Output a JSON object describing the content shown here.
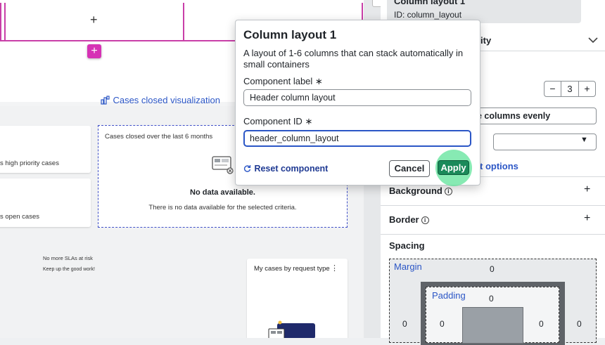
{
  "canvas": {
    "viz_link": "Cases closed visualization",
    "card_high_priority": "s high priority cases",
    "card_open_cases": "s open cases",
    "chart_card_title": "Cases closed over the last 6 months",
    "no_data_title": "No data available.",
    "no_data_desc": "There is no data available for the selected criteria.",
    "sla_title": "No more SLAs at risk",
    "sla_sub": "Keep up the good work!",
    "request_type_title": "My cases by request type"
  },
  "panel": {
    "header_title": "Column layout 1",
    "header_id": "ID: column_layout",
    "partial_ity": "ity",
    "stepper_minus": "−",
    "stepper_value": "3",
    "stepper_plus": "+",
    "distribute_label": "e columns evenly",
    "more_options": "t options",
    "sections": {
      "background": "Background",
      "border": "Border",
      "spacing": "Spacing"
    },
    "spacing": {
      "margin_label": "Margin",
      "margin_top": "0",
      "margin_left": "0",
      "margin_right": "0",
      "padding_label": "Padding",
      "padding_top": "0",
      "padding_left": "0",
      "padding_right": "0"
    }
  },
  "modal": {
    "title": "Column layout 1",
    "description": "A layout of 1-6 columns that can stack automatically in small containers",
    "label_field_label": "Component label",
    "label_field_value": "Header column layout",
    "id_field_label": "Component ID",
    "id_field_value": "header_column_layout",
    "reset_label": "Reset component",
    "cancel_label": "Cancel",
    "apply_label": "Apply",
    "required_mark": "∗"
  },
  "colors": {
    "accent": "#c93fa8",
    "link": "#2b56c6",
    "apply": "#1b8a5a",
    "highlight": "#5fe39a"
  },
  "icons": [
    "plus-icon",
    "chart-icon",
    "info-icon",
    "chevron-down-icon",
    "reset-icon",
    "no-data-icon",
    "kebab-icon"
  ]
}
